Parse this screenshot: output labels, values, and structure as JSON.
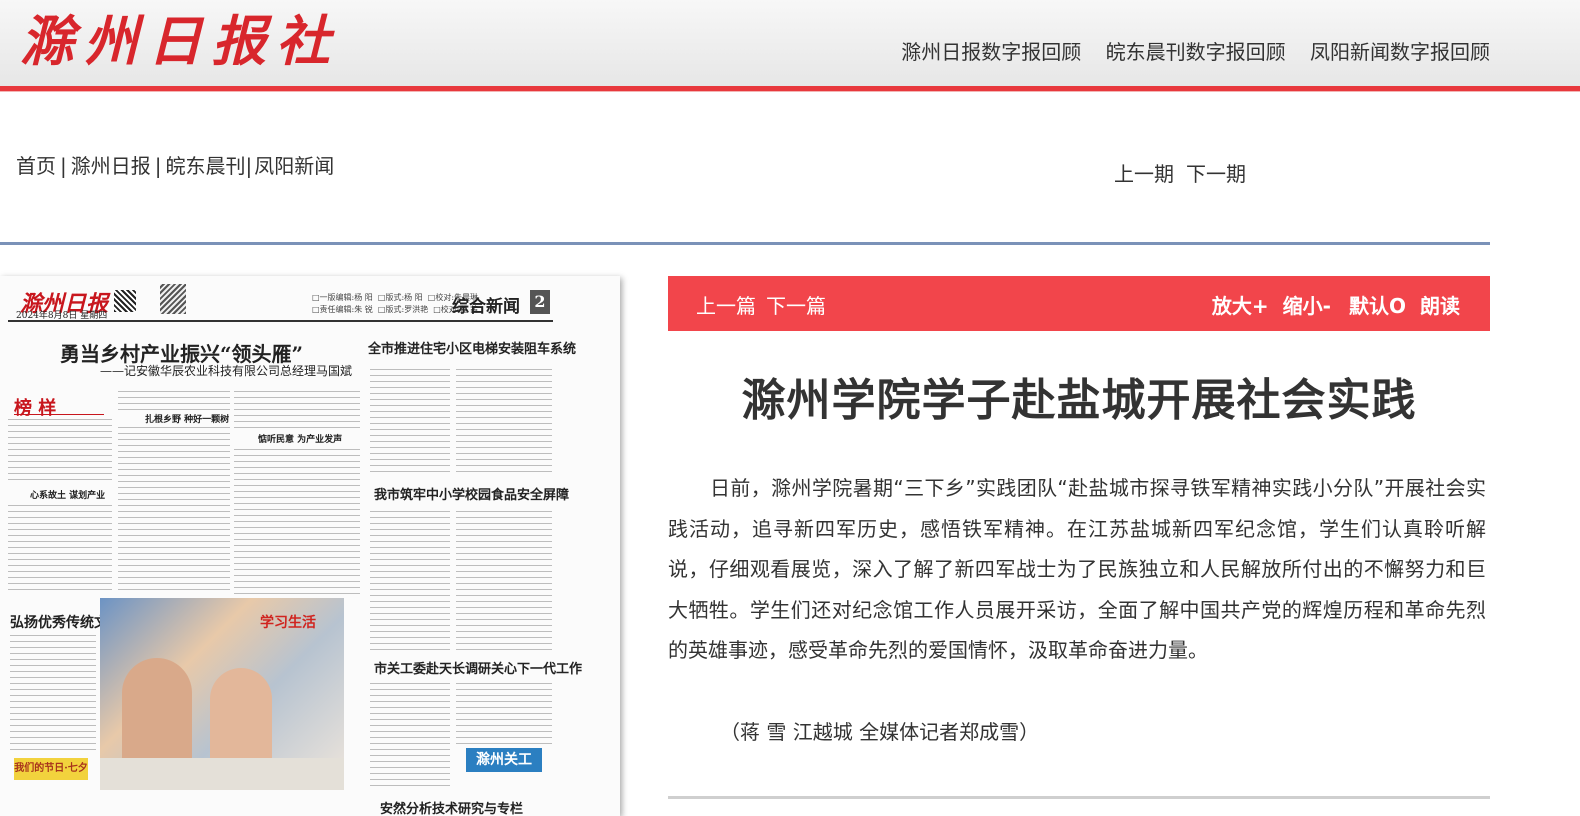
{
  "header": {
    "logo": "滁州日报社",
    "nav": [
      "滁州日报数字报回顾",
      "皖东晨刊数字报回顾",
      "凤阳新闻数字报回顾"
    ]
  },
  "subnav": {
    "home": "首页",
    "items": [
      "滁州日报",
      "皖东晨刊",
      "凤阳新闻"
    ]
  },
  "issue_nav": {
    "prev": "上一期",
    "next": "下一期"
  },
  "newspaper": {
    "logo": "滁州日报",
    "date": "2024年8月8日  星期四",
    "section": "综合新闻",
    "page_num": "2",
    "editors": "□一版编辑:杨 阳  □版式:杨 阳  □校对:朱晨琳\n□责任编辑:朱 锐  □版式:罗洪艳  □校对:程 茜",
    "headline_main": "勇当乡村产业振兴“领头雁”",
    "headline_sub": "——记安徽华辰农业科技有限公司总经理马国斌",
    "badge": "榜 样",
    "headline_right1": "全市推进住宅小区电梯安装阻车系统",
    "headline_right2": "我市筑牢中小学校园食品安全屏障",
    "headline_left2": "弘扬优秀传统文化迎七夕",
    "headline_right3": "市关工委赴天长调研关心下一代工作",
    "headline_bottom": "安然分析技术研究与专栏",
    "sub_heads": [
      "心系故土  谋划产业",
      "扎根乡野  种好一颗树",
      "惦听民意  为产业发声"
    ],
    "tag": "滁州关工",
    "yellow_tag": "我们的节日·七夕",
    "photo_sign": "学习生活"
  },
  "article_bar": {
    "prev": "上一篇",
    "next": "下一篇",
    "tools": [
      "放大+",
      "缩小-",
      "默认O",
      "朗读"
    ]
  },
  "article": {
    "title": "滁州学院学子赴盐城开展社会实践",
    "body": "日前，滁州学院暑期“三下乡”实践团队“赴盐城市探寻铁军精神实践小分队”开展社会实践活动，追寻新四军历史，感悟铁军精神。在江苏盐城新四军纪念馆，学生们认真聆听解说，仔细观看展览，深入了解了新四军战士为了民族独立和人民解放所付出的不懈努力和巨大牺牲。学生们还对纪念馆工作人员展开采访，全面了解中国共产党的辉煌历程和革命先烈的英雄事迹，感受革命先烈的爱国情怀，汲取革命奋进力量。",
    "byline": "（蒋 雪 江越城 全媒体记者郑成雪）"
  },
  "colors": {
    "brand_red": "#d8262c",
    "bar_red": "#f2454b",
    "divider_blue": "#7a92b8"
  }
}
